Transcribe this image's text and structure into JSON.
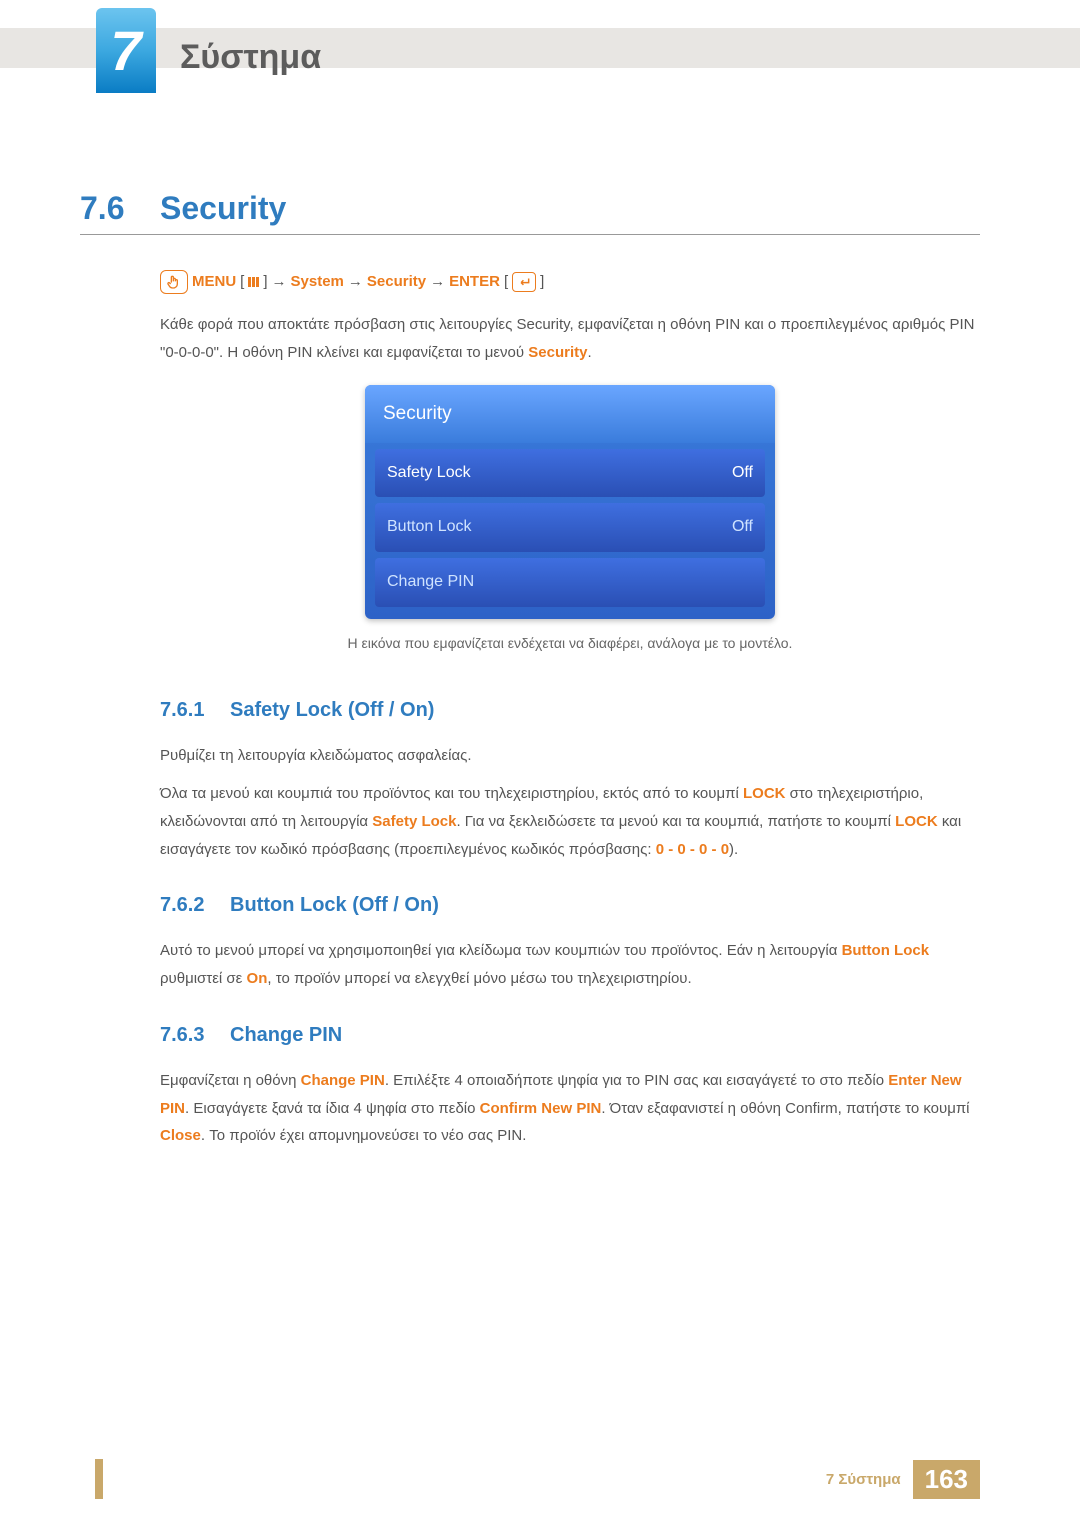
{
  "chapter": {
    "number": "7",
    "title": "Σύστημα"
  },
  "section": {
    "number": "7.6",
    "title": "Security"
  },
  "menu_path": {
    "menu_label": "MENU",
    "system": "System",
    "security": "Security",
    "enter": "ENTER"
  },
  "intro": {
    "line1_a": "Κάθε φορά που αποκτάτε πρόσβαση στις λειτουργίες Security, εμφανίζεται η οθόνη PIN και ο προεπιλεγμένος αριθμός PIN \"0-0-0-0\". Η οθόνη PIN κλείνει και εμφανίζεται το μενού ",
    "security_word": "Security",
    "period": "."
  },
  "screenshot": {
    "title": "Security",
    "rows": [
      {
        "label": "Safety Lock",
        "value": "Off"
      },
      {
        "label": "Button Lock",
        "value": "Off"
      },
      {
        "label": "Change PIN",
        "value": ""
      }
    ],
    "caption": "Η εικόνα που εμφανίζεται ενδέχεται να διαφέρει, ανάλογα με το μοντέλο."
  },
  "subsections": {
    "s1": {
      "num": "7.6.1",
      "title": "Safety Lock (Off / On)",
      "p1": "Ρυθμίζει τη λειτουργία κλειδώματος ασφαλείας.",
      "p2_a": "Όλα τα μενού και κουμπιά του προϊόντος και του τηλεχειριστηρίου, εκτός από το κουμπί ",
      "lock1": "LOCK",
      "p2_b": " στο τηλεχειριστήριο, κλειδώνονται από τη λειτουργία ",
      "safety_lock": "Safety Lock",
      "p2_c": ". Για να ξεκλειδώσετε τα μενού και τα κουμπιά, πατήστε το κουμπί ",
      "lock2": "LOCK",
      "p2_d": " και εισαγάγετε τον κωδικό πρόσβασης (προεπιλεγμένος κωδικός πρόσβασης: ",
      "pin": "0 - 0 - 0 - 0",
      "p2_e": ")."
    },
    "s2": {
      "num": "7.6.2",
      "title": "Button Lock (Off / On)",
      "p1_a": "Αυτό το μενού μπορεί να χρησιμοποιηθεί για κλείδωμα των κουμπιών του προϊόντος. Εάν η λειτουργία ",
      "button_lock": "Button Lock",
      "p1_b": " ρυθμιστεί σε ",
      "on": "On",
      "p1_c": ", το προϊόν μπορεί να ελεγχθεί μόνο μέσω του τηλεχειριστηρίου."
    },
    "s3": {
      "num": "7.6.3",
      "title": "Change PIN",
      "p1_a": "Εμφανίζεται η οθόνη ",
      "change_pin": "Change PIN",
      "p1_b": ". Επιλέξτε 4 οποιαδήποτε ψηφία για το PIN σας και εισαγάγετέ το στο πεδίο ",
      "enter_new": "Enter New PIN",
      "p1_c": ". Εισαγάγετε ξανά τα ίδια 4 ψηφία στο πεδίο ",
      "confirm_new": "Confirm New PIN",
      "p1_d": ". Όταν εξαφανιστεί η οθόνη Confirm, πατήστε το κουμπί ",
      "close": "Close",
      "p1_e": ". Το προϊόν έχει απομνημονεύσει το νέο σας PIN."
    }
  },
  "footer": {
    "label": "7 Σύστημα",
    "page": "163"
  }
}
